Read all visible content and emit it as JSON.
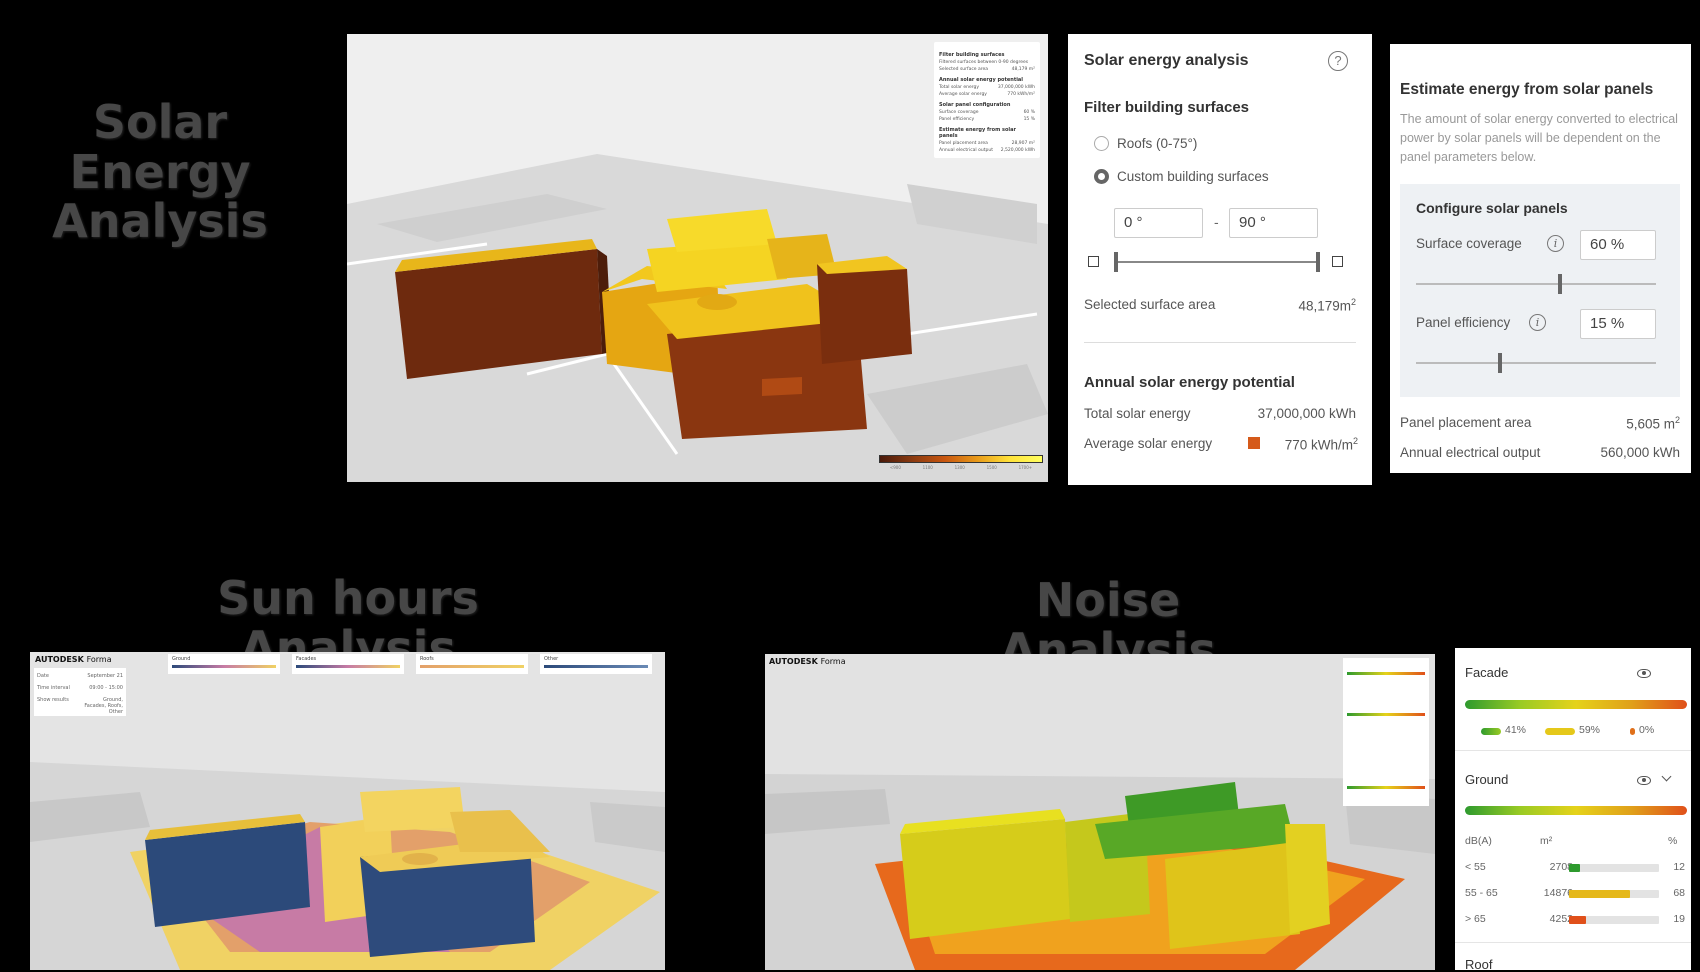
{
  "headings": {
    "solar": "Solar Energy Analysis",
    "sun": "Sun hours Analysis",
    "noise": "Noise Analysis"
  },
  "solar_viewport": {
    "mini_panel": {
      "filter_title": "Filter building surfaces",
      "filter_desc": "Filtered surfaces between 0-90 degrees",
      "selected_label": "Selected surface area",
      "selected_value": "48,179 m²",
      "annual_title": "Annual solar energy potential",
      "total_label": "Total solar energy",
      "total_value": "37,000,000 kWh",
      "avg_label": "Average solar energy",
      "avg_value": "770 kWh/m²",
      "config_title": "Solar panel configuration",
      "coverage_label": "Surface coverage",
      "coverage_value": "60 %",
      "efficiency_label": "Panel efficiency",
      "efficiency_value": "15 %",
      "estimate_title": "Estimate energy from solar panels",
      "placement_label": "Panel placement area",
      "placement_value": "28,907 m²",
      "output_label": "Annual electrical output",
      "output_value": "2,520,000 kWh"
    },
    "legend_ticks": [
      "<900",
      "1100",
      "1300",
      "1500",
      "1700+"
    ]
  },
  "solar_panel": {
    "title": "Solar energy analysis",
    "help": "?",
    "filter_title": "Filter building surfaces",
    "radio_roofs": "Roofs (0-75°)",
    "radio_custom": "Custom building surfaces",
    "min_angle": "0  °",
    "max_angle": "90  °",
    "dash": "-",
    "selected_label": "Selected surface area",
    "selected_value": "48,179",
    "selected_unit": "m",
    "annual_title": "Annual solar energy potential",
    "total_label": "Total solar energy",
    "total_value": "37,000,000 kWh",
    "avg_label": "Average solar energy",
    "avg_value": "770 kWh/m",
    "avg_color": "#d55a1a"
  },
  "estimate_panel": {
    "title": "Estimate energy from solar panels",
    "description": "The amount of solar energy converted to electrical power by solar panels will be dependent on the panel parameters below.",
    "config_title": "Configure solar panels",
    "coverage_label": "Surface coverage",
    "coverage_value": "60  %",
    "coverage_fraction": 0.6,
    "efficiency_label": "Panel efficiency",
    "efficiency_value": "15  %",
    "efficiency_fraction": 0.35,
    "placement_label": "Panel placement area",
    "placement_value": "5,605 m",
    "output_label": "Annual electrical output",
    "output_value": "560,000 kWh"
  },
  "sun_viewport": {
    "logo": "AUTODESK",
    "logo_product": "Forma",
    "info": [
      {
        "label": "Date",
        "value": "September 21"
      },
      {
        "label": "Time interval",
        "value": "09:00 - 15:00"
      },
      {
        "label": "Show results",
        "value": "Ground, Facades, Roofs, Other"
      }
    ],
    "legends": [
      "Ground",
      "Facades",
      "Roofs",
      "Other"
    ]
  },
  "noise_viewport": {
    "logo": "AUTODESK",
    "logo_product": "Forma"
  },
  "noise_panel": {
    "facade_label": "Facade",
    "facade_pills": [
      "41%",
      "59%",
      "0%"
    ],
    "ground_label": "Ground",
    "col_db": "dB(A)",
    "col_m2": "m²",
    "col_pct": "%",
    "rows": [
      {
        "range": "< 55",
        "area": "2708",
        "pct": "12",
        "fraction": 0.12,
        "color": "#2e9a2e"
      },
      {
        "range": "55 - 65",
        "area": "14876",
        "pct": "68",
        "fraction": 0.68,
        "color": "#e5b81a"
      },
      {
        "range": "> 65",
        "area": "4252",
        "pct": "19",
        "fraction": 0.19,
        "color": "#e0501a"
      }
    ],
    "roof_label": "Roof"
  }
}
